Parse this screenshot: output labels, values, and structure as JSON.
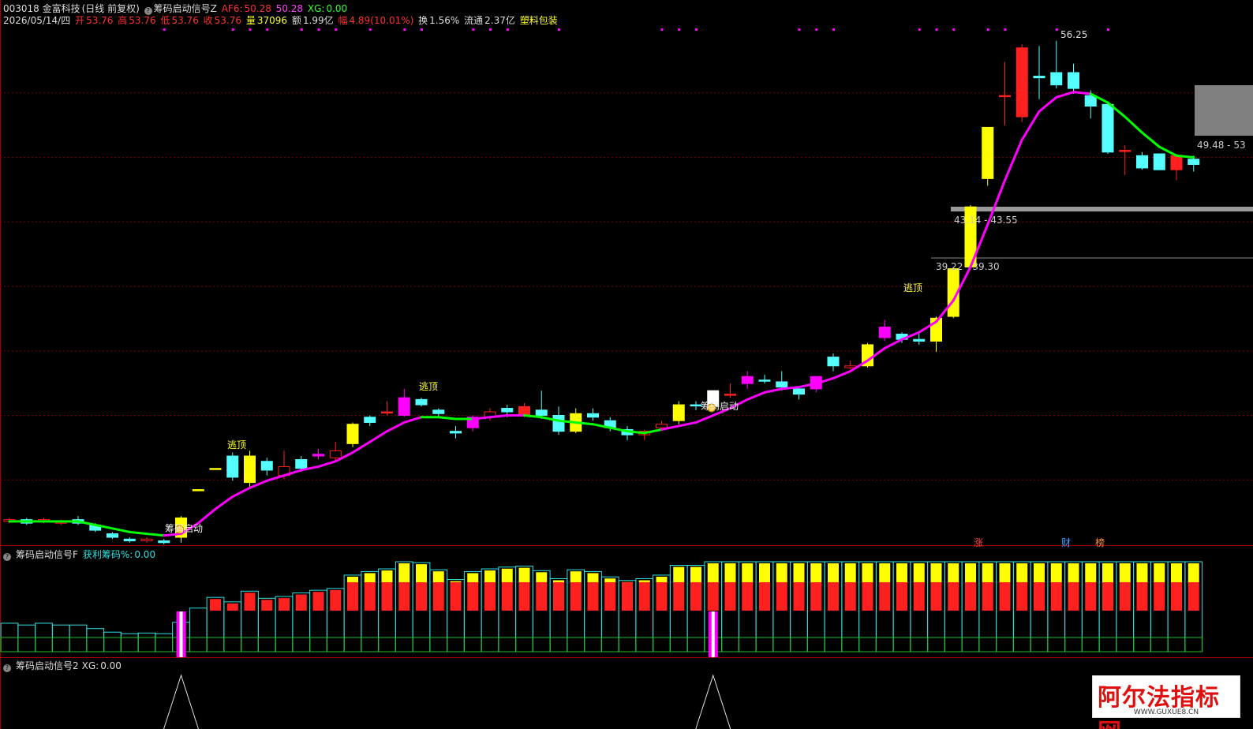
{
  "header": {
    "code_name": "003018 金富科技",
    "period": "(日线 前复权)",
    "indicator": "筹码启动信号Z",
    "af6_label": "AF6:",
    "af6_value": "50.28",
    "af6b_value": "50.28",
    "xg_label": "XG:",
    "xg_value": "0.00"
  },
  "quote": {
    "date": "2026/05/14/四",
    "open_label": "开",
    "open": "53.76",
    "high_label": "高",
    "high": "53.76",
    "low_label": "低",
    "low": "53.76",
    "close_label": "收",
    "close": "53.76",
    "vol_label": "量",
    "vol": "37096",
    "amt_label": "额",
    "amt": "1.99亿",
    "chg_label": "幅",
    "chg": "4.89(10.01%)",
    "turn_label": "换",
    "turn": "1.56%",
    "float_label": "流通",
    "float": "2.37亿",
    "sector": "塑料包装"
  },
  "price_labels": {
    "peak": "56.25",
    "right": "49.48 - 53",
    "zone1": "43.14 - 43.55",
    "zone2": "39.22 - 39.30"
  },
  "signals": {
    "escape": "逃顶",
    "chip_start": "筹码启动"
  },
  "panel2": {
    "title": "筹码启动信号F",
    "profit_label": "获利筹码%:",
    "profit_value": "0.00"
  },
  "panel3": {
    "title": "筹码启动信号2",
    "xg_label": "XG:",
    "xg_value": "0.00"
  },
  "tags": {
    "zhang": "涨",
    "cai": "财",
    "bang": "榜"
  },
  "watermark": {
    "title": "阿尔法指标网",
    "url": "WWW.GUXUE8.CN"
  },
  "colors": {
    "up": "#ff2020",
    "down": "#55ffff",
    "yellow": "#ffff00",
    "magenta": "#ff00ff",
    "green": "#00ff00",
    "grid": "#7a0000"
  },
  "chart_data": {
    "type": "candlestick",
    "candles": [
      {
        "o": 29.0,
        "c": 29.1,
        "h": 29.2,
        "l": 28.9,
        "k": "up"
      },
      {
        "o": 29.1,
        "c": 28.9,
        "h": 29.2,
        "l": 28.8,
        "k": "down"
      },
      {
        "o": 29.0,
        "c": 29.1,
        "h": 29.2,
        "l": 28.9,
        "k": "up"
      },
      {
        "o": 29.0,
        "c": 28.9,
        "h": 29.1,
        "l": 28.8,
        "k": "up"
      },
      {
        "o": 29.1,
        "c": 28.9,
        "h": 29.3,
        "l": 28.8,
        "k": "down"
      },
      {
        "o": 28.8,
        "c": 28.5,
        "h": 28.9,
        "l": 28.4,
        "k": "down"
      },
      {
        "o": 28.3,
        "c": 28.1,
        "h": 28.4,
        "l": 28.0,
        "k": "down"
      },
      {
        "o": 28.0,
        "c": 27.9,
        "h": 28.1,
        "l": 27.8,
        "k": "down"
      },
      {
        "o": 27.9,
        "c": 28.0,
        "h": 28.1,
        "l": 27.8,
        "k": "up"
      },
      {
        "o": 27.9,
        "c": 27.8,
        "h": 28.0,
        "l": 27.7,
        "k": "down"
      },
      {
        "o": 28.1,
        "c": 29.2,
        "h": 29.3,
        "l": 27.8,
        "k": "yellow"
      },
      {
        "o": 30.8,
        "c": 30.8,
        "h": 30.8,
        "l": 30.8,
        "k": "yellow"
      },
      {
        "o": 32.0,
        "c": 32.0,
        "h": 32.0,
        "l": 32.0,
        "k": "yellow"
      },
      {
        "o": 32.7,
        "c": 31.5,
        "h": 32.9,
        "l": 31.3,
        "k": "down"
      },
      {
        "o": 31.2,
        "c": 32.7,
        "h": 33.0,
        "l": 30.9,
        "k": "yellow"
      },
      {
        "o": 32.4,
        "c": 31.9,
        "h": 32.6,
        "l": 31.6,
        "k": "down"
      },
      {
        "o": 31.6,
        "c": 32.1,
        "h": 33.0,
        "l": 31.4,
        "k": "up"
      },
      {
        "o": 32.0,
        "c": 32.5,
        "h": 32.7,
        "l": 31.8,
        "k": "down"
      },
      {
        "o": 32.7,
        "c": 32.8,
        "h": 33.1,
        "l": 32.5,
        "k": "magenta"
      },
      {
        "o": 32.6,
        "c": 33.0,
        "h": 33.5,
        "l": 32.4,
        "k": "up"
      },
      {
        "o": 33.4,
        "c": 34.5,
        "h": 34.6,
        "l": 33.2,
        "k": "yellow"
      },
      {
        "o": 34.6,
        "c": 34.9,
        "h": 35.0,
        "l": 34.4,
        "k": "down"
      },
      {
        "o": 35.2,
        "c": 35.2,
        "h": 35.8,
        "l": 35.0,
        "k": "red"
      },
      {
        "o": 35.0,
        "c": 36.0,
        "h": 36.5,
        "l": 34.9,
        "k": "magenta"
      },
      {
        "o": 35.6,
        "c": 35.9,
        "h": 36.0,
        "l": 35.5,
        "k": "down"
      },
      {
        "o": 35.3,
        "c": 35.1,
        "h": 35.4,
        "l": 34.9,
        "k": "down"
      },
      {
        "o": 34.1,
        "c": 34.0,
        "h": 34.4,
        "l": 33.7,
        "k": "down"
      },
      {
        "o": 34.3,
        "c": 34.9,
        "h": 35.0,
        "l": 34.1,
        "k": "magenta"
      },
      {
        "o": 34.9,
        "c": 35.2,
        "h": 35.4,
        "l": 34.7,
        "k": "up"
      },
      {
        "o": 35.2,
        "c": 35.4,
        "h": 35.6,
        "l": 34.9,
        "k": "down"
      },
      {
        "o": 35.0,
        "c": 35.5,
        "h": 35.7,
        "l": 34.9,
        "k": "red"
      },
      {
        "o": 35.3,
        "c": 35.0,
        "h": 36.4,
        "l": 34.8,
        "k": "down"
      },
      {
        "o": 35.0,
        "c": 34.1,
        "h": 35.5,
        "l": 33.9,
        "k": "down"
      },
      {
        "o": 34.1,
        "c": 35.1,
        "h": 35.4,
        "l": 34.0,
        "k": "yellow"
      },
      {
        "o": 35.1,
        "c": 34.9,
        "h": 35.4,
        "l": 34.7,
        "k": "down"
      },
      {
        "o": 34.7,
        "c": 34.3,
        "h": 34.9,
        "l": 34.1,
        "k": "down"
      },
      {
        "o": 34.2,
        "c": 33.9,
        "h": 34.4,
        "l": 33.6,
        "k": "down"
      },
      {
        "o": 33.9,
        "c": 34.1,
        "h": 34.2,
        "l": 33.6,
        "k": "up"
      },
      {
        "o": 34.3,
        "c": 34.5,
        "h": 34.7,
        "l": 34.1,
        "k": "up"
      },
      {
        "o": 34.7,
        "c": 35.6,
        "h": 35.8,
        "l": 34.5,
        "k": "yellow"
      },
      {
        "o": 35.6,
        "c": 35.6,
        "h": 35.8,
        "l": 35.3,
        "k": "down"
      },
      {
        "o": 35.5,
        "c": 36.4,
        "h": 36.4,
        "l": 35.4,
        "k": "white"
      },
      {
        "o": 36.2,
        "c": 36.2,
        "h": 36.8,
        "l": 36.0,
        "k": "red"
      },
      {
        "o": 36.8,
        "c": 37.2,
        "h": 37.5,
        "l": 36.5,
        "k": "magenta"
      },
      {
        "o": 37.0,
        "c": 37.0,
        "h": 37.3,
        "l": 36.8,
        "k": "down"
      },
      {
        "o": 36.9,
        "c": 36.6,
        "h": 37.5,
        "l": 36.4,
        "k": "down"
      },
      {
        "o": 36.5,
        "c": 36.2,
        "h": 36.6,
        "l": 35.9,
        "k": "down"
      },
      {
        "o": 36.5,
        "c": 37.2,
        "h": 37.2,
        "l": 36.3,
        "k": "magenta"
      },
      {
        "o": 37.8,
        "c": 38.3,
        "h": 38.5,
        "l": 37.5,
        "k": "down"
      },
      {
        "o": 37.7,
        "c": 37.8,
        "h": 38.1,
        "l": 37.6,
        "k": "up"
      },
      {
        "o": 37.8,
        "c": 39.0,
        "h": 39.1,
        "l": 37.7,
        "k": "yellow"
      },
      {
        "o": 39.4,
        "c": 40.0,
        "h": 40.4,
        "l": 39.2,
        "k": "magenta"
      },
      {
        "o": 39.6,
        "c": 39.3,
        "h": 39.7,
        "l": 39.1,
        "k": "down"
      },
      {
        "o": 39.3,
        "c": 39.2,
        "h": 39.7,
        "l": 39.0,
        "k": "down"
      },
      {
        "o": 39.2,
        "c": 40.5,
        "h": 40.6,
        "l": 38.6,
        "k": "yellow"
      },
      {
        "o": 40.6,
        "c": 43.3,
        "h": 43.4,
        "l": 40.5,
        "k": "yellow"
      },
      {
        "o": 43.4,
        "c": 46.8,
        "h": 46.9,
        "l": 43.3,
        "k": "yellow"
      },
      {
        "o": 48.4,
        "c": 51.3,
        "h": 51.3,
        "l": 48.0,
        "k": "yellow"
      },
      {
        "o": 53.1,
        "c": 53.1,
        "h": 55.0,
        "l": 51.4,
        "k": "red"
      },
      {
        "o": 51.9,
        "c": 55.8,
        "h": 56.0,
        "l": 51.6,
        "k": "red"
      },
      {
        "o": 54.2,
        "c": 54.1,
        "h": 55.9,
        "l": 52.9,
        "k": "down"
      },
      {
        "o": 54.4,
        "c": 53.7,
        "h": 56.2,
        "l": 53.5,
        "k": "down"
      },
      {
        "o": 54.4,
        "c": 53.5,
        "h": 54.9,
        "l": 53.2,
        "k": "down"
      },
      {
        "o": 53.1,
        "c": 52.5,
        "h": 53.4,
        "l": 51.8,
        "k": "down"
      },
      {
        "o": 52.6,
        "c": 49.9,
        "h": 52.7,
        "l": 49.8,
        "k": "down"
      },
      {
        "o": 50.0,
        "c": 50.0,
        "h": 50.3,
        "l": 48.6,
        "k": "red"
      },
      {
        "o": 49.7,
        "c": 49.0,
        "h": 49.9,
        "l": 48.9,
        "k": "down"
      },
      {
        "o": 49.8,
        "c": 48.9,
        "h": 49.8,
        "l": 48.9,
        "k": "down"
      },
      {
        "o": 49.7,
        "c": 48.9,
        "h": 49.8,
        "l": 48.3,
        "k": "red"
      },
      {
        "o": 49.5,
        "c": 49.2,
        "h": 49.7,
        "l": 48.8,
        "k": "down"
      }
    ],
    "ma": [
      29.0,
      29.0,
      29.0,
      29.0,
      29.0,
      28.8,
      28.6,
      28.4,
      28.3,
      28.2,
      28.3,
      28.9,
      29.7,
      30.4,
      30.9,
      31.3,
      31.6,
      31.9,
      32.1,
      32.4,
      32.9,
      33.5,
      34.1,
      34.6,
      34.9,
      34.9,
      34.8,
      34.8,
      34.9,
      35.0,
      35.0,
      34.9,
      34.7,
      34.6,
      34.5,
      34.3,
      34.1,
      34.0,
      34.2,
      34.4,
      34.6,
      35.0,
      35.4,
      35.9,
      36.3,
      36.5,
      36.6,
      36.8,
      37.1,
      37.5,
      38.1,
      38.8,
      39.3,
      39.7,
      40.3,
      41.5,
      43.4,
      45.8,
      48.3,
      50.6,
      52.2,
      53.0,
      53.3,
      53.2,
      52.7,
      51.9,
      51.0,
      50.2,
      49.7,
      49.6,
      50.2
    ],
    "ma_color": [
      "g",
      "g",
      "g",
      "g",
      "g",
      "g",
      "g",
      "g",
      "g",
      "g",
      "m",
      "m",
      "m",
      "m",
      "m",
      "m",
      "m",
      "m",
      "m",
      "m",
      "m",
      "m",
      "m",
      "m",
      "m",
      "g",
      "g",
      "g",
      "m",
      "m",
      "m",
      "g",
      "g",
      "g",
      "g",
      "g",
      "g",
      "g",
      "g",
      "m",
      "m",
      "m",
      "m",
      "m",
      "m",
      "m",
      "m",
      "m",
      "m",
      "m",
      "m",
      "m",
      "m",
      "m",
      "m",
      "m",
      "m",
      "m",
      "m",
      "m",
      "m",
      "m",
      "m",
      "m",
      "g",
      "g",
      "g",
      "g",
      "g",
      "g",
      "m"
    ],
    "ylim": [
      27.7,
      56.9
    ],
    "dots_x_index": [
      9,
      13,
      14,
      15,
      17,
      18,
      19,
      21,
      23,
      24,
      27,
      28,
      29,
      32,
      38,
      39,
      40,
      46,
      47,
      48,
      53,
      54,
      55,
      57,
      58,
      61,
      64
    ]
  }
}
